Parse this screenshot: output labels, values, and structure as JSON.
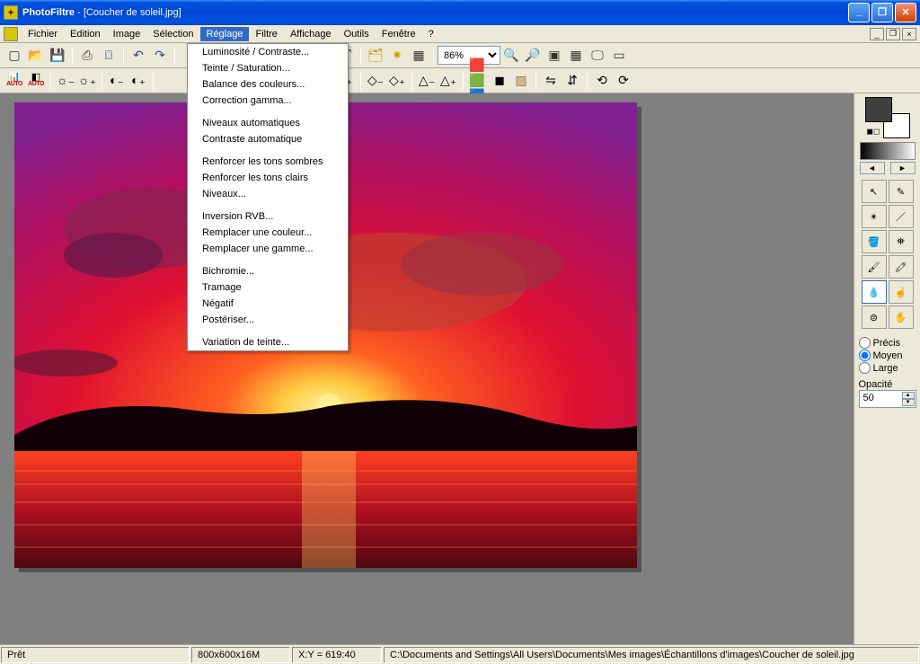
{
  "title": {
    "app": "PhotoFiltre",
    "doc": "[Coucher de soleil.jpg]"
  },
  "menus": {
    "m0": "Fichier",
    "m1": "Edition",
    "m2": "Image",
    "m3": "Sélection",
    "m4": "Réglage",
    "m5": "Filtre",
    "m6": "Affichage",
    "m7": "Outils",
    "m8": "Fenêtre",
    "m9": "?"
  },
  "dropdown": {
    "i0": "Luminosité / Contraste...",
    "i1": "Teinte / Saturation...",
    "i2": "Balance des couleurs...",
    "i3": "Correction gamma...",
    "i4": "Niveaux automatiques",
    "i5": "Contraste automatique",
    "i6": "Renforcer les tons sombres",
    "i7": "Renforcer les tons clairs",
    "i8": "Niveaux...",
    "i9": "Inversion RVB...",
    "i10": "Remplacer une couleur...",
    "i11": "Remplacer une gamme...",
    "i12": "Bichromie...",
    "i13": "Tramage",
    "i14": "Négatif",
    "i15": "Postériser...",
    "i16": "Variation de teinte..."
  },
  "zoom": "86%",
  "status": {
    "ready": "Prêt",
    "dims": "800x600x16M",
    "xy": "X:Y = 619:40",
    "path": "C:\\Documents and Settings\\All Users\\Documents\\Mes images\\Échantillons d'images\\Coucher de soleil.jpg"
  },
  "brush": {
    "o0": "Précis",
    "o1": "Moyen",
    "o2": "Large",
    "opLabel": "Opacité",
    "opVal": "50"
  },
  "auto": "AUTO"
}
